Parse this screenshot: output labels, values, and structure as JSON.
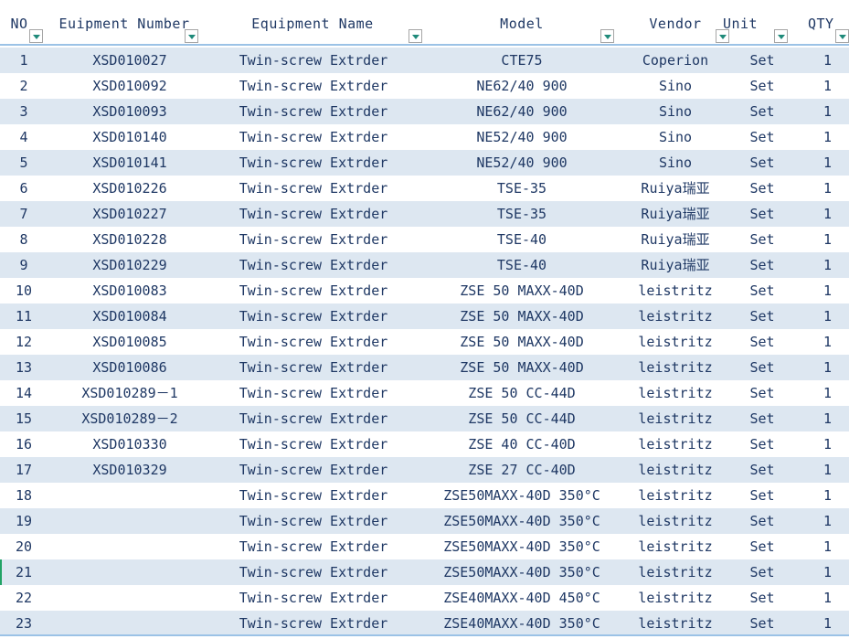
{
  "columns": [
    {
      "label": "NO"
    },
    {
      "label": "Euipment Number"
    },
    {
      "label": "Equipment Name"
    },
    {
      "label": "Model"
    },
    {
      "label": "Vendor"
    },
    {
      "label": "Unit"
    },
    {
      "label": "QTY"
    }
  ],
  "rows": [
    {
      "no": "1",
      "number": "XSD010027",
      "name": "Twin-screw Extrder",
      "model": "CTE75",
      "vendor": "Coperion",
      "unit": "Set",
      "qty": "1"
    },
    {
      "no": "2",
      "number": "XSD010092",
      "name": "Twin-screw Extrder",
      "model": "NE62/40 900",
      "vendor": "Sino",
      "unit": "Set",
      "qty": "1"
    },
    {
      "no": "3",
      "number": "XSD010093",
      "name": "Twin-screw Extrder",
      "model": "NE62/40 900",
      "vendor": "Sino",
      "unit": "Set",
      "qty": "1"
    },
    {
      "no": "4",
      "number": "XSD010140",
      "name": "Twin-screw Extrder",
      "model": "NE52/40 900",
      "vendor": "Sino",
      "unit": "Set",
      "qty": "1"
    },
    {
      "no": "5",
      "number": "XSD010141",
      "name": "Twin-screw Extrder",
      "model": "NE52/40 900",
      "vendor": "Sino",
      "unit": "Set",
      "qty": "1"
    },
    {
      "no": "6",
      "number": "XSD010226",
      "name": "Twin-screw Extrder",
      "model": "TSE-35",
      "vendor": "Ruiya瑞亚",
      "unit": "Set",
      "qty": "1"
    },
    {
      "no": "7",
      "number": "XSD010227",
      "name": "Twin-screw Extrder",
      "model": "TSE-35",
      "vendor": "Ruiya瑞亚",
      "unit": "Set",
      "qty": "1"
    },
    {
      "no": "8",
      "number": "XSD010228",
      "name": "Twin-screw Extrder",
      "model": "TSE-40",
      "vendor": "Ruiya瑞亚",
      "unit": "Set",
      "qty": "1"
    },
    {
      "no": "9",
      "number": "XSD010229",
      "name": "Twin-screw Extrder",
      "model": "TSE-40",
      "vendor": "Ruiya瑞亚",
      "unit": "Set",
      "qty": "1"
    },
    {
      "no": "10",
      "number": "XSD010083",
      "name": "Twin-screw Extrder",
      "model": "ZSE 50 MAXX-40D",
      "vendor": "leistritz",
      "unit": "Set",
      "qty": "1"
    },
    {
      "no": "11",
      "number": "XSD010084",
      "name": "Twin-screw Extrder",
      "model": "ZSE 50 MAXX-40D",
      "vendor": "leistritz",
      "unit": "Set",
      "qty": "1"
    },
    {
      "no": "12",
      "number": "XSD010085",
      "name": "Twin-screw Extrder",
      "model": "ZSE 50 MAXX-40D",
      "vendor": "leistritz",
      "unit": "Set",
      "qty": "1"
    },
    {
      "no": "13",
      "number": "XSD010086",
      "name": "Twin-screw Extrder",
      "model": "ZSE 50 MAXX-40D",
      "vendor": "leistritz",
      "unit": "Set",
      "qty": "1"
    },
    {
      "no": "14",
      "number": "XSD010289－1",
      "name": "Twin-screw Extrder",
      "model": "ZSE 50 CC-44D",
      "vendor": "leistritz",
      "unit": "Set",
      "qty": "1"
    },
    {
      "no": "15",
      "number": "XSD010289－2",
      "name": "Twin-screw Extrder",
      "model": "ZSE 50 CC-44D",
      "vendor": "leistritz",
      "unit": "Set",
      "qty": "1"
    },
    {
      "no": "16",
      "number": "XSD010330",
      "name": "Twin-screw Extrder",
      "model": "ZSE 40 CC-40D",
      "vendor": "leistritz",
      "unit": "Set",
      "qty": "1"
    },
    {
      "no": "17",
      "number": "XSD010329",
      "name": "Twin-screw Extrder",
      "model": "ZSE 27 CC-40D",
      "vendor": "leistritz",
      "unit": "Set",
      "qty": "1"
    },
    {
      "no": "18",
      "number": "",
      "name": "Twin-screw Extrder",
      "model": "ZSE50MAXX-40D 350°C",
      "vendor": "leistritz",
      "unit": "Set",
      "qty": "1"
    },
    {
      "no": "19",
      "number": "",
      "name": "Twin-screw Extrder",
      "model": "ZSE50MAXX-40D 350°C",
      "vendor": "leistritz",
      "unit": "Set",
      "qty": "1"
    },
    {
      "no": "20",
      "number": "",
      "name": "Twin-screw Extrder",
      "model": "ZSE50MAXX-40D 350°C",
      "vendor": "leistritz",
      "unit": "Set",
      "qty": "1"
    },
    {
      "no": "21",
      "number": "",
      "name": "Twin-screw Extrder",
      "model": "ZSE50MAXX-40D 350°C",
      "vendor": "leistritz",
      "unit": "Set",
      "qty": "1"
    },
    {
      "no": "22",
      "number": "",
      "name": "Twin-screw Extrder",
      "model": "ZSE40MAXX-40D 450°C",
      "vendor": "leistritz",
      "unit": "Set",
      "qty": "1"
    },
    {
      "no": "23",
      "number": "",
      "name": "Twin-screw Extrder",
      "model": "ZSE40MAXX-40D 350°C",
      "vendor": "leistritz",
      "unit": "Set",
      "qty": "1"
    }
  ],
  "icons": {
    "filter": "filter-dropdown-icon"
  },
  "colors": {
    "text": "#1f3864",
    "band": "#dde7f1",
    "header_border": "#9bc2e6",
    "filter_arrow": "#1f8a7a"
  }
}
